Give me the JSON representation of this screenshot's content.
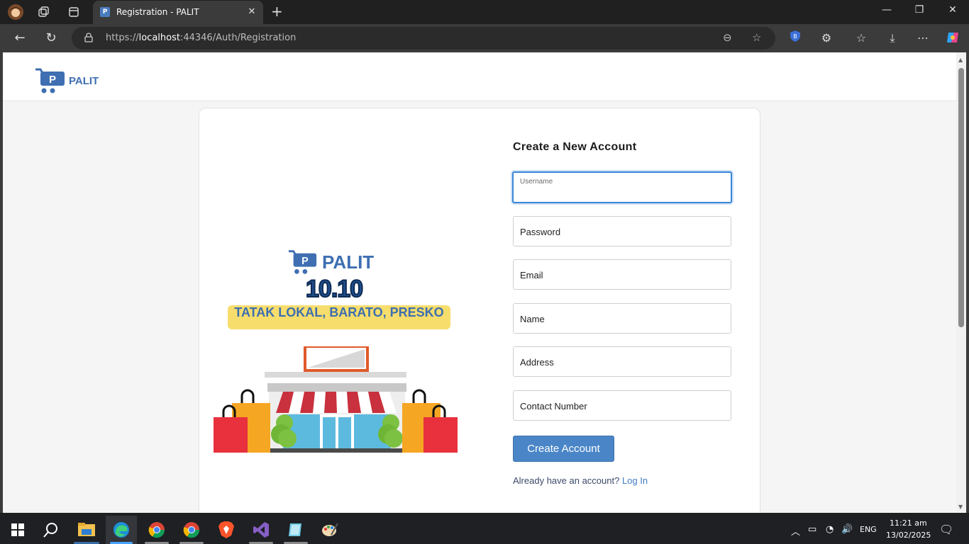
{
  "browser": {
    "tab_title": "Registration - PALIT",
    "tab_close": "✕",
    "tab_favicon_letter": "P",
    "url_prefix": "https://",
    "url_host": "localhost",
    "url_rest": ":44346/Auth/Registration",
    "new_tab": "+",
    "minimize": "—",
    "restore": "❐",
    "close": "✕"
  },
  "site": {
    "logo_text": "PALIT"
  },
  "promo": {
    "brand": "PALIT",
    "date": "10.10",
    "tagline": "TATAK LOKAL, BARATO, PRESKO"
  },
  "form": {
    "title": "Create a New Account",
    "fields": [
      {
        "label": "Username",
        "value": ""
      },
      {
        "label": "Password",
        "value": ""
      },
      {
        "label": "Email",
        "value": ""
      },
      {
        "label": "Name",
        "value": ""
      },
      {
        "label": "Address",
        "value": ""
      },
      {
        "label": "Contact Number",
        "value": ""
      }
    ],
    "submit_label": "Create Account",
    "login_prompt": "Already have an account?",
    "login_link": "Log In"
  },
  "taskbar": {
    "language": "ENG",
    "time": "11:21 am",
    "date": "13/02/2025"
  },
  "colors": {
    "brand_blue": "#3f6fb2",
    "button_blue": "#4a86c7",
    "focus_blue": "#3b86d8",
    "banner_yellow": "#f7dd6c"
  }
}
